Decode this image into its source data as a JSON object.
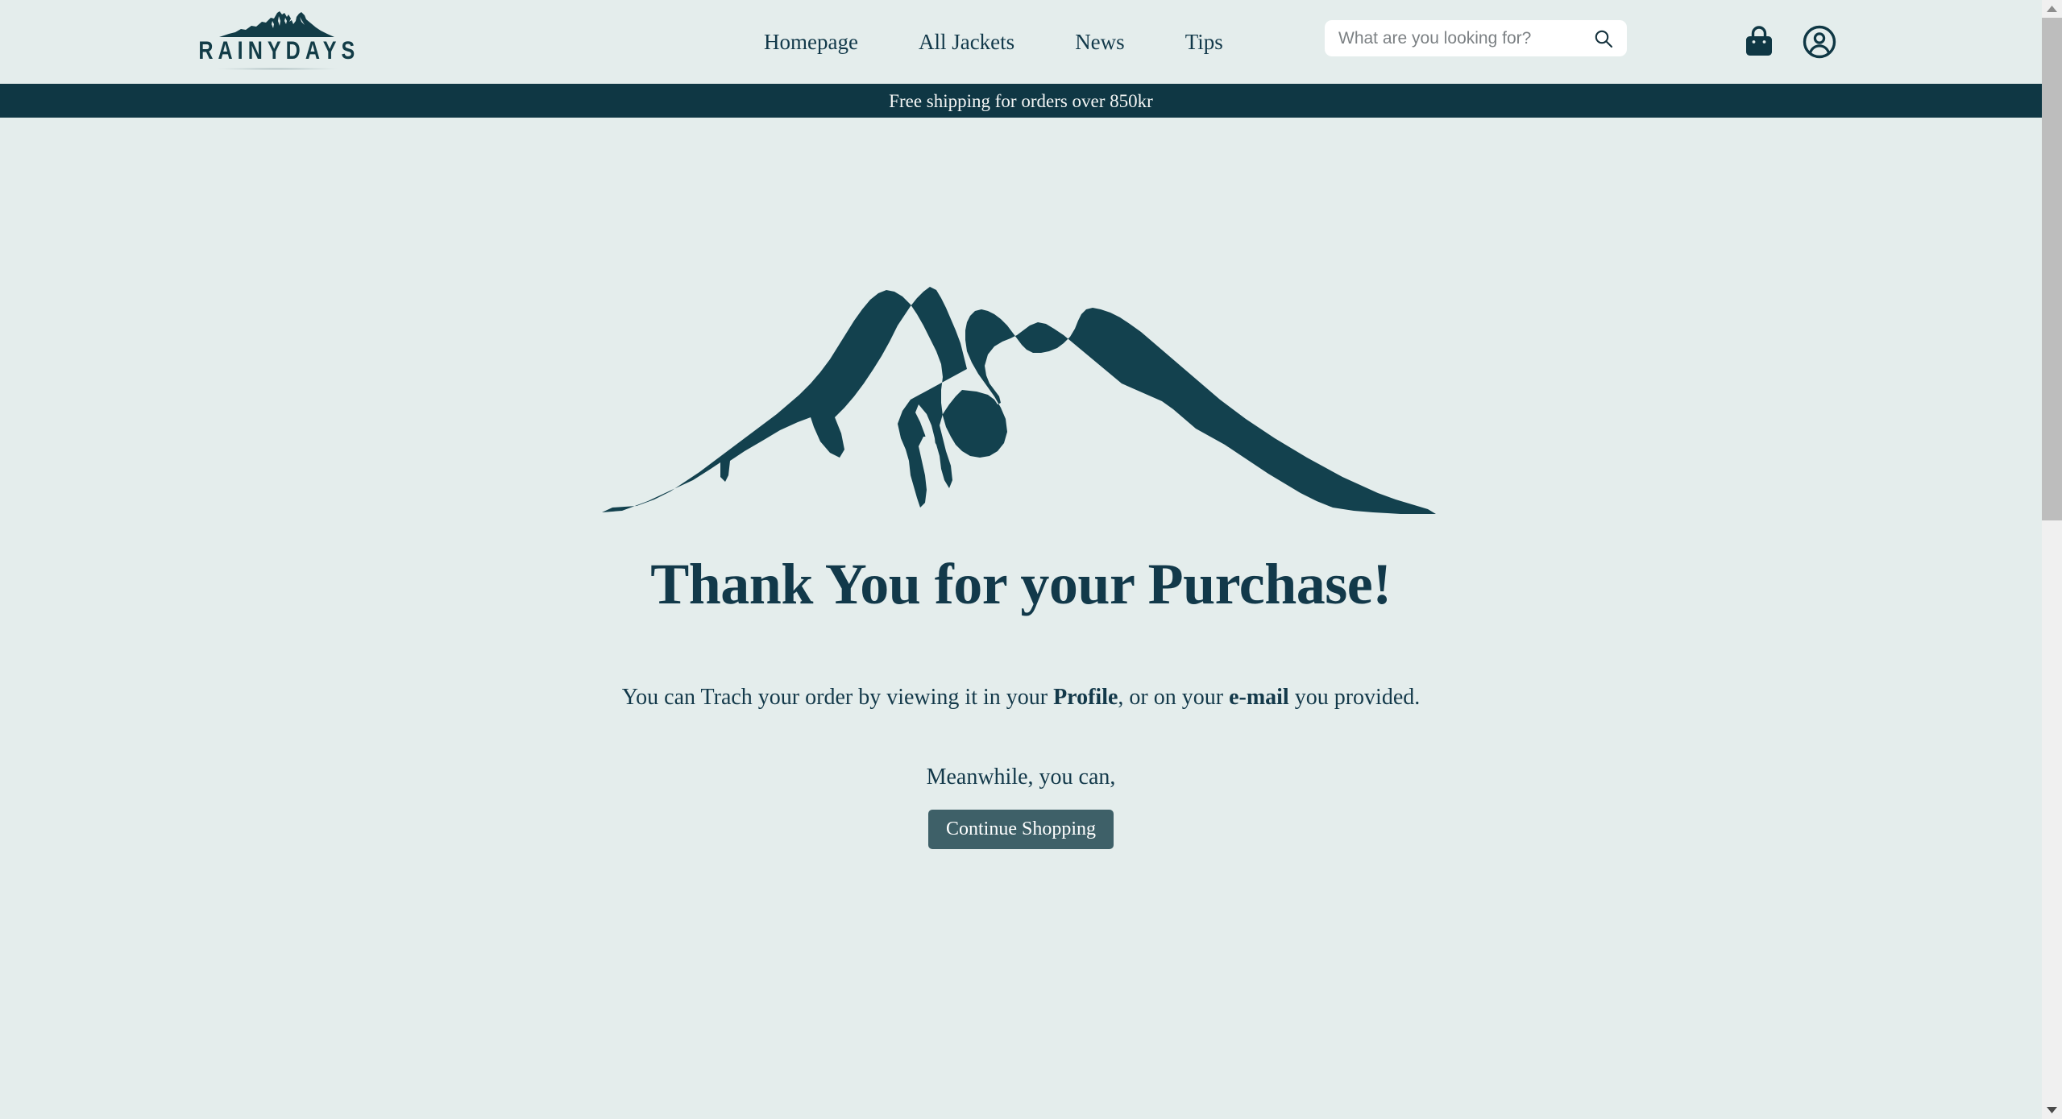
{
  "colors": {
    "page_bg": "#e4edec",
    "dark_teal": "#0f3744",
    "text_teal": "#12394a",
    "button_bg": "#3e6068",
    "banner_text": "#f4f6f5",
    "search_bg": "#ffffff",
    "placeholder": "#7c8184",
    "scrollbar_track": "#f0f0f0",
    "scrollbar_thumb": "#bdbdbd"
  },
  "header": {
    "logo": {
      "wordmark": "RAINYDAYS",
      "mark_icon": "mountain-logo-icon"
    },
    "nav": [
      {
        "label": "Homepage",
        "name": "nav-link-homepage"
      },
      {
        "label": "All Jackets",
        "name": "nav-link-all-jackets"
      },
      {
        "label": "News",
        "name": "nav-link-news"
      },
      {
        "label": "Tips",
        "name": "nav-link-tips"
      }
    ],
    "search": {
      "placeholder": "What are you looking for?",
      "value": "",
      "icon": "search-icon"
    },
    "icons": [
      {
        "name": "shopping-bag-icon",
        "label": "Cart"
      },
      {
        "name": "user-account-icon",
        "label": "Account"
      }
    ]
  },
  "banner": {
    "text": "Free shipping for orders over 850kr"
  },
  "main": {
    "hero_icon": "mountain-illustration-icon",
    "title": "Thank You for your Purchase!",
    "subtitle": {
      "part1": "You can Trach your order by viewing it in your ",
      "bold1": "Profile",
      "part2": ", or on your ",
      "bold2": "e-mail",
      "part3": " you provided."
    },
    "meanwhile": "Meanwhile, you can,",
    "cta_label": "Continue Shopping"
  },
  "scrollbar": {
    "up_arrow": "▲",
    "down_arrow": "▼"
  }
}
